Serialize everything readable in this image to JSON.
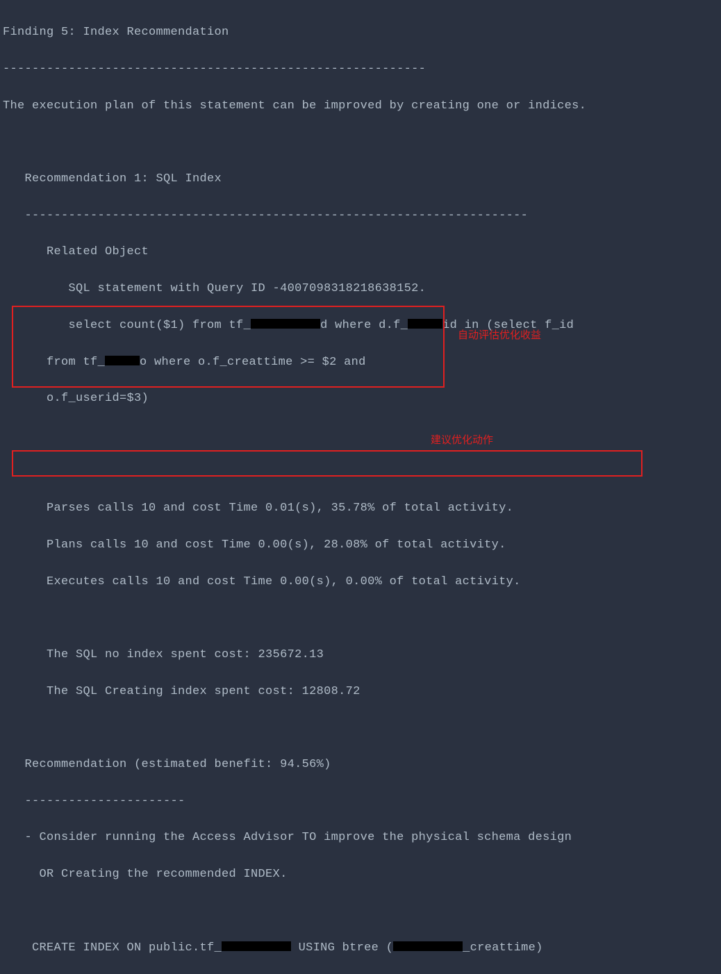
{
  "terminal": {
    "finding_title": "Finding 5: Index Recommendation",
    "sep1": "----------------------------------------------------------",
    "finding_desc": "The execution plan of this statement can be improved by creating one or indices.",
    "rec_title": "   Recommendation 1: SQL Index",
    "sep2": "   ---------------------------------------------------------------------",
    "related_obj": "      Related Object",
    "sql_stmt_id": "         SQL statement with Query ID -4007098318218638152.",
    "sql_line1_a": "         select count($1) from tf_",
    "sql_line1_b": "d where d.f_",
    "sql_line1_c": "id in (select f_id",
    "sql_line2_a": "      from tf_",
    "sql_line2_b": "o where o.f_creattime >= $2 and",
    "sql_line3": "      o.f_userid=$3)",
    "parses": "      Parses calls 10 and cost Time 0.01(s), 35.78% of total activity.",
    "plans": "      Plans calls 10 and cost Time 0.00(s), 28.08% of total activity.",
    "executes": "      Executes calls 10 and cost Time 0.00(s), 0.00% of total activity.",
    "cost_noindex": "      The SQL no index spent cost: 235672.13",
    "cost_index": "      The SQL Creating index spent cost: 12808.72",
    "rec_benefit": "   Recommendation (estimated benefit: 94.56%)",
    "sep3": "   ----------------------",
    "advice1": "   - Consider running the Access Advisor TO improve the physical schema design",
    "advice2": "     OR Creating the recommended INDEX.",
    "create_idx_a": "    CREATE INDEX ON public.tf_",
    "create_idx_b": " USING btree (",
    "create_idx_c": "_creattime)"
  },
  "annotations": {
    "label1": "自动评估优化收益",
    "label2": "建议优化动作"
  }
}
